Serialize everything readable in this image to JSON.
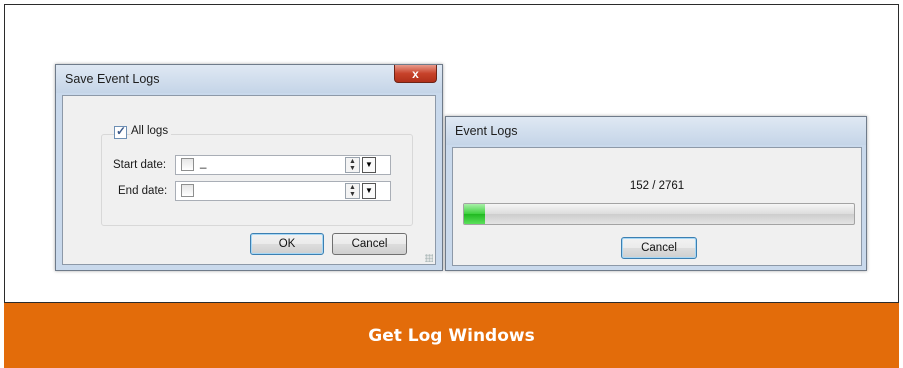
{
  "footer": {
    "title": "Get Log Windows"
  },
  "save_dialog": {
    "title": "Save Event Logs",
    "close_glyph": "x",
    "all_logs": {
      "label": "All logs",
      "checked": true
    },
    "start_date": {
      "label": "Start date:",
      "value": "_",
      "checked": false
    },
    "end_date": {
      "label": "End date:",
      "value": "",
      "checked": false
    },
    "ok_label": "OK",
    "cancel_label": "Cancel"
  },
  "progress_dialog": {
    "title": "Event Logs",
    "counter": "152 / 2761",
    "progress_fraction": 0.055,
    "cancel_label": "Cancel"
  },
  "colors": {
    "footer_bg": "#e36c0a",
    "progress": "#3dd03d"
  }
}
